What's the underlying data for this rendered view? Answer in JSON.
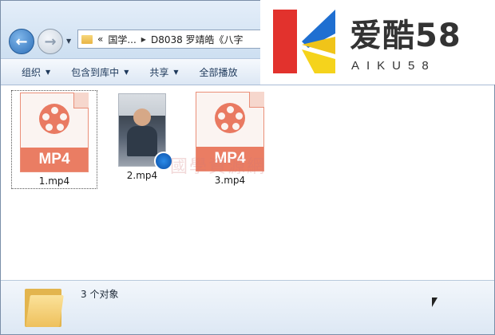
{
  "address": {
    "overflow": "«",
    "segments": [
      "国学...",
      "D8038 罗靖皓《八字"
    ]
  },
  "toolbar": {
    "items": [
      {
        "label": "组织"
      },
      {
        "label": "包含到库中"
      },
      {
        "label": "共享"
      },
      {
        "label": "全部播放"
      }
    ]
  },
  "files": [
    {
      "name": "1.mp4",
      "icon_text": "MP4",
      "type": "mp4-icon",
      "selected": true
    },
    {
      "name": "2.mp4",
      "type": "video-thumbnail"
    },
    {
      "name": "3.mp4",
      "icon_text": "MP4",
      "type": "mp4-icon",
      "selected": false
    }
  ],
  "content_watermark": "國學資源網",
  "status": {
    "text": "3 个对象"
  },
  "logo": {
    "title": "爱酷58",
    "subtitle": "AIKU58"
  },
  "colors": {
    "mp4_accent": "#ea7d63",
    "toolbar_text": "#1e395b"
  }
}
